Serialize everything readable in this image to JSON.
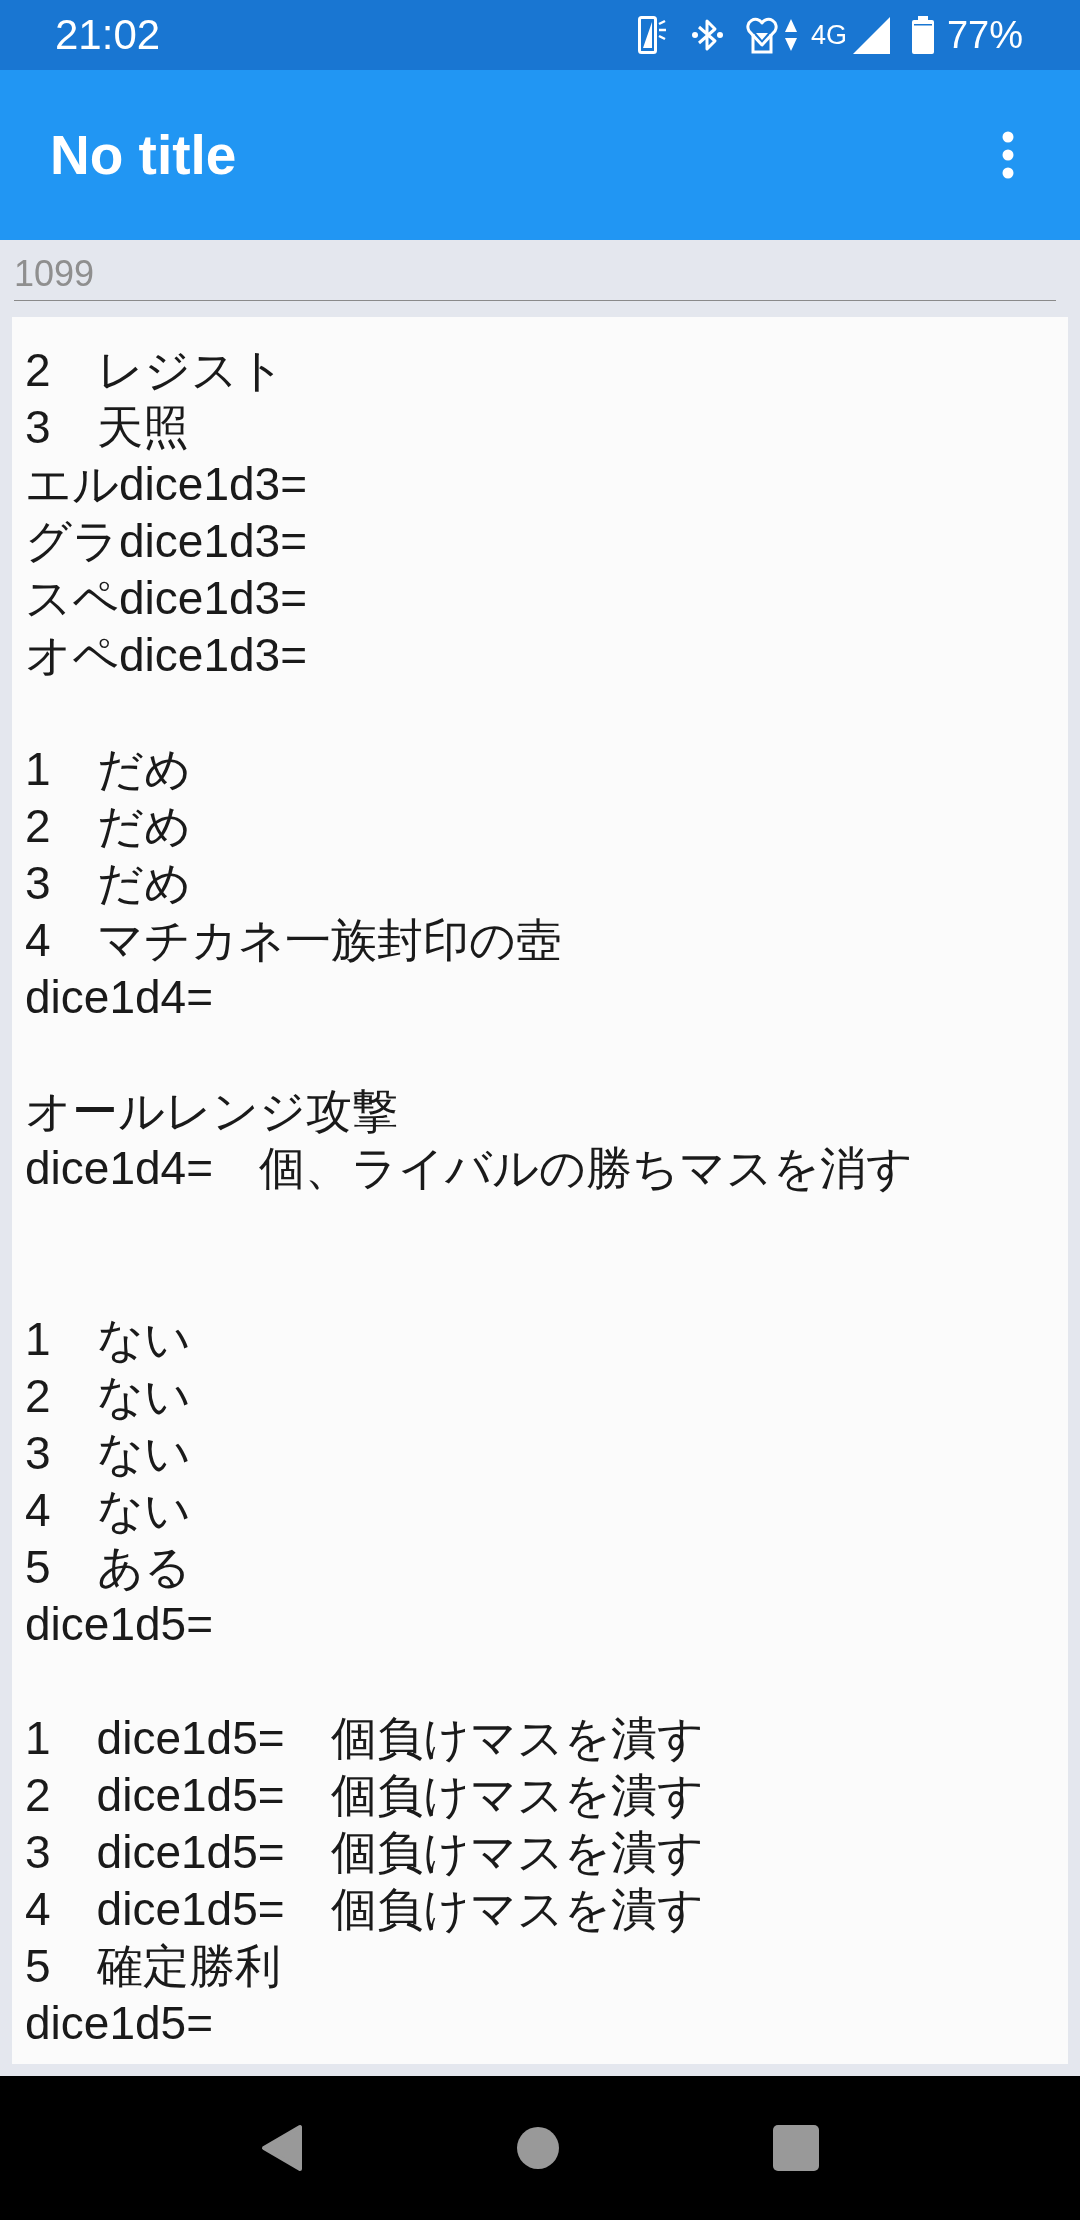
{
  "status_bar": {
    "time": "21:02",
    "network": "4G",
    "battery": "77%"
  },
  "app_bar": {
    "title": "No title"
  },
  "input": {
    "placeholder": "1099"
  },
  "text_area": {
    "lines": [
      {
        "kind": "text",
        "text": "2　レジスト"
      },
      {
        "kind": "text",
        "text": "3　天照"
      },
      {
        "kind": "text",
        "text": "エルdice1d3="
      },
      {
        "kind": "text",
        "text": "グラdice1d3="
      },
      {
        "kind": "text",
        "text": "スペdice1d3="
      },
      {
        "kind": "text",
        "text": "オペdice1d3="
      },
      {
        "kind": "blank"
      },
      {
        "kind": "text",
        "text": "1　だめ"
      },
      {
        "kind": "text",
        "text": "2　だめ"
      },
      {
        "kind": "text",
        "text": "3　だめ"
      },
      {
        "kind": "text",
        "text": "4　マチカネ一族封印の壺"
      },
      {
        "kind": "text",
        "text": "dice1d4="
      },
      {
        "kind": "blank"
      },
      {
        "kind": "text",
        "text": "オールレンジ攻撃"
      },
      {
        "kind": "text",
        "text": "dice1d4=　個、ライバルの勝ちマスを消す"
      },
      {
        "kind": "blank"
      },
      {
        "kind": "blank"
      },
      {
        "kind": "text",
        "text": "1　ない"
      },
      {
        "kind": "text",
        "text": "2　ない"
      },
      {
        "kind": "text",
        "text": "3　ない"
      },
      {
        "kind": "text",
        "text": "4　ない"
      },
      {
        "kind": "text",
        "text": "5　ある"
      },
      {
        "kind": "text",
        "text": "dice1d5="
      },
      {
        "kind": "blank"
      },
      {
        "kind": "text",
        "text": "1　dice1d5=　個負けマスを潰す"
      },
      {
        "kind": "text",
        "text": "2　dice1d5=　個負けマスを潰す"
      },
      {
        "kind": "text",
        "text": "3　dice1d5=　個負けマスを潰す"
      },
      {
        "kind": "text",
        "text": "4　dice1d5=　個負けマスを潰す"
      },
      {
        "kind": "text",
        "text": "5　確定勝利"
      },
      {
        "kind": "text",
        "text": "dice1d5="
      }
    ]
  }
}
